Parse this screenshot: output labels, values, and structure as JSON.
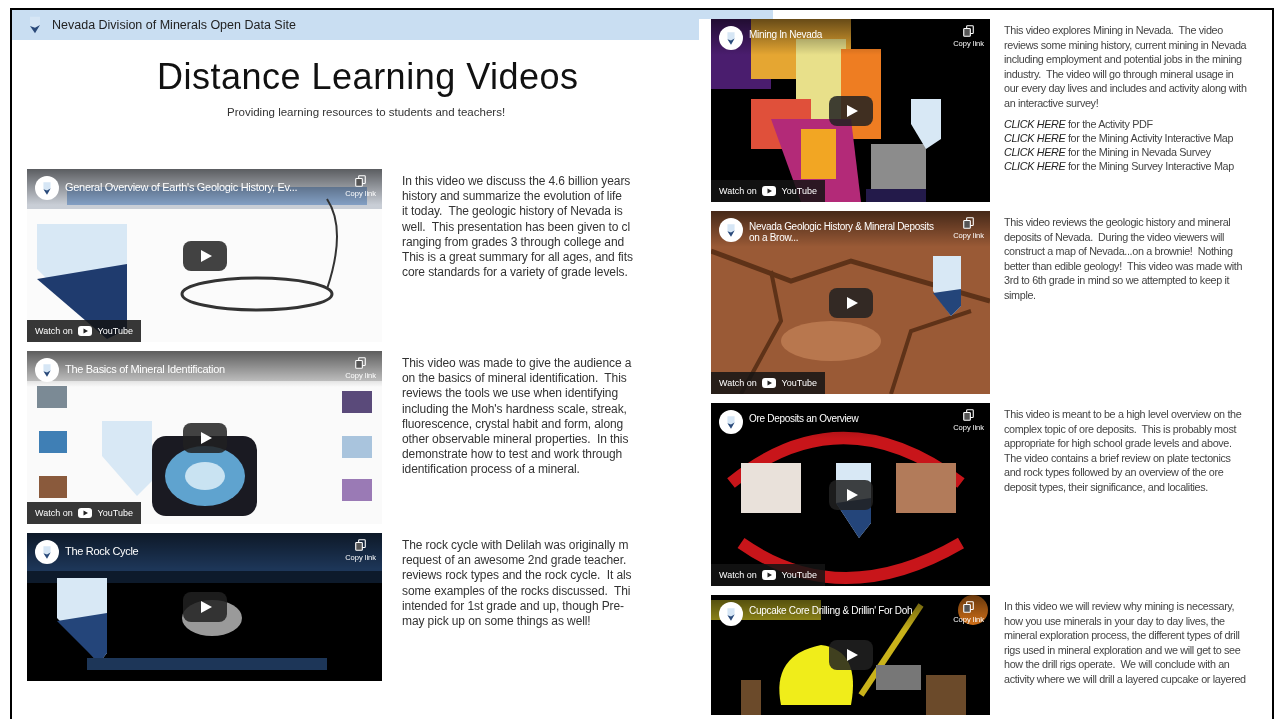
{
  "header": {
    "site_title": "Nevada Division of Minerals Open Data Site"
  },
  "page": {
    "title": "Distance Learning Videos",
    "subtitle": "Providing learning resources to students and teachers!"
  },
  "left_videos": [
    {
      "video": {
        "title": "General Overview of Earth's Geologic History, Ev...",
        "copy_link": "Copy link",
        "watch_on": "Watch on",
        "brand": "YouTube"
      },
      "description": "In this video we discuss the 4.6 billion years\nhistory and summarize the evolution of life\nit today.  The geologic history of Nevada is\nwell.  This presentation has been given to cl\nranging from grades 3 through college and\nThis is a great summary for all ages, and fits\ncore standards for a variety of grade levels."
    },
    {
      "video": {
        "title": "The Basics of Mineral Identification",
        "copy_link": "Copy link",
        "watch_on": "Watch on",
        "brand": "YouTube"
      },
      "description": "This video was made to give the audience a\non the basics of mineral identification.  This\nreviews the tools we use when identifying\nincluding the Moh's hardness scale, streak,\nfluorescence, crystal habit and form, along\nother observable mineral properties.  In this\ndemonstrate how to test and work through\nidentification process of a mineral."
    },
    {
      "video": {
        "title": "The Rock Cycle",
        "copy_link": "Copy link"
      },
      "description": "The rock cycle with Delilah was originally m\nrequest of an awesome 2nd grade teacher.\nreviews rock types and the rock cycle.  It als\nsome examples of the rocks discussed.  Thi\nintended for 1st grade and up, though Pre-\nmay pick up on some things as well!"
    }
  ],
  "right_videos": [
    {
      "video": {
        "title": "Mining In Nevada",
        "copy_link": "Copy link",
        "watch_on": "Watch on",
        "brand": "YouTube"
      },
      "description": "This video explores Mining in Nevada.  The video\nreviews some mining history, current mining in Nevada\nincluding employment and potential jobs in the mining\nindustry.  The video will go through mineral usage in\nour every day lives and includes and activity along with\nan interactive survey!",
      "links": [
        {
          "link": "CLICK HERE",
          "text": "for the Activity PDF"
        },
        {
          "link": "CLICK HERE",
          "text": "for the Mining Activity Interactive Map"
        },
        {
          "link": "CLICK HERE",
          "text": "for the Mining in Nevada Survey"
        },
        {
          "link": "CLICK HERE",
          "text": "for the Mining Survey Interactive Map"
        }
      ]
    },
    {
      "video": {
        "title": "Nevada Geologic History & Mineral Deposits on a Brow...",
        "copy_link": "Copy link",
        "watch_on": "Watch on",
        "brand": "YouTube"
      },
      "description": "This video reviews the geologic history and mineral\ndeposits of Nevada.  During the video viewers will\nconstruct a map of Nevada...on a brownie!  Nothing\nbetter than edible geology!  This video was made with\n3rd to 6th grade in mind so we attempted to keep it\nsimple."
    },
    {
      "video": {
        "title": "Ore Deposits an Overview",
        "copy_link": "Copy link",
        "watch_on": "Watch on",
        "brand": "YouTube"
      },
      "description": "This video is meant to be a high level overview on the\ncomplex topic of ore deposits.  This is probably most\nappropriate for high school grade levels and above.\nThe video contains a brief review on plate tectonics\nand rock types followed by an overview of the ore\ndeposit types, their significance, and localities."
    },
    {
      "video": {
        "title": "Cupcake Core Drilling & Drillin' For Doh",
        "copy_link": "Copy link"
      },
      "description": "In this video we will review why mining is necessary,\nhow you use minerals in your day to day lives, the\nmineral exploration process, the different types of drill\nrigs used in mineral exploration and we will get to see\nhow the drill rigs operate.  We will conclude with an\nactivity where we will drill a layered cupcake or layered"
    }
  ]
}
